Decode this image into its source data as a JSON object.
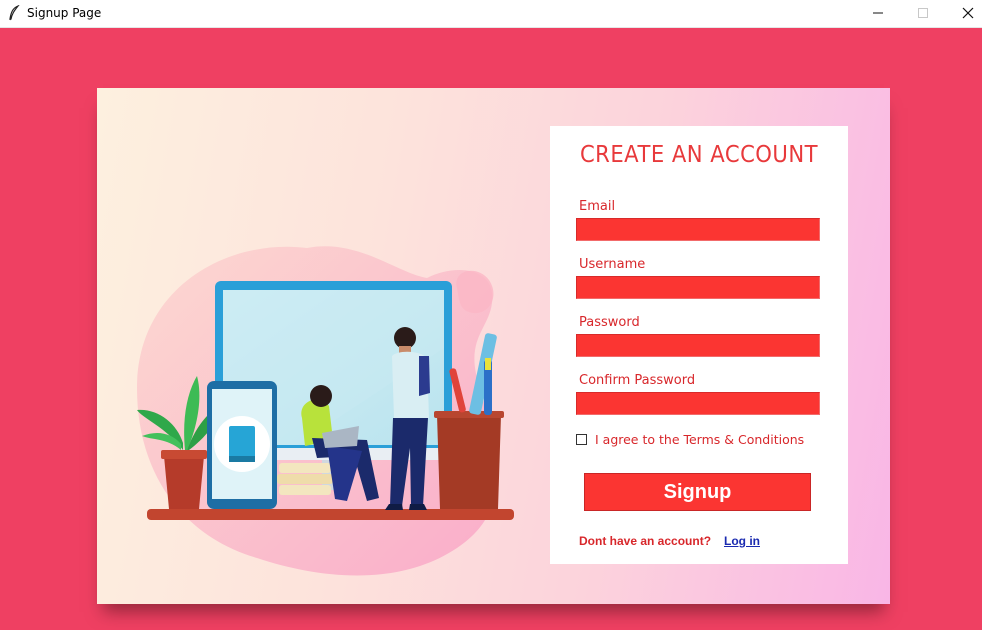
{
  "window": {
    "title": "Signup Page",
    "app_icon": "feather-icon",
    "controls": [
      "minimize-icon",
      "maximize-icon",
      "close-icon"
    ]
  },
  "form": {
    "heading": "CREATE AN ACCOUNT",
    "fields": [
      {
        "label": "Email",
        "value": ""
      },
      {
        "label": "Username",
        "value": ""
      },
      {
        "label": "Password",
        "value": ""
      },
      {
        "label": "Confirm Password",
        "value": ""
      }
    ],
    "terms_label": "I agree to the Terms & Conditions",
    "terms_checked": false,
    "signup_label": "Signup",
    "account_prompt": "Dont have an account?",
    "login_label": "Log in"
  },
  "colors": {
    "background": "#ef4062",
    "accent": "#fb3532",
    "text_accent": "#d8272b",
    "link": "#1a2ab0"
  }
}
